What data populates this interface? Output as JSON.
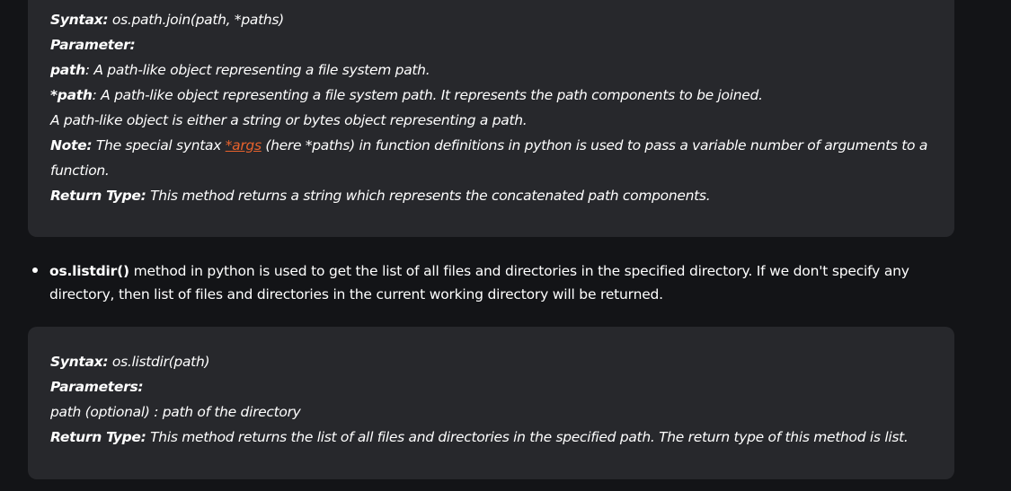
{
  "block1": {
    "syntax_label": "Syntax:",
    "syntax_value": " os.path.join(path, *paths)",
    "parameter_label": "Parameter:",
    "path_label": "path",
    "path_desc": ": A path-like object representing a file system path.",
    "star_path_label": "*path",
    "star_path_desc": ": A path-like object representing a file system path. It represents the path components to be joined.",
    "pathlike_note": "A path-like object is either a string or bytes object representing a path.",
    "note_label": "Note:",
    "note_pre": " The special syntax ",
    "note_link": "*args",
    "note_post": " (here *paths) in function definitions in python is used to pass a variable number of arguments to a function.",
    "return_label": "Return Type:",
    "return_desc": " This method returns a string which represents the concatenated path components."
  },
  "bullet": {
    "method": "os.listdir()",
    "text": " method in python is used to get the list of all files and directories in the specified directory. If we don't specify any directory, then list of files and directories in the current working directory will be returned."
  },
  "block2": {
    "syntax_label": "Syntax:",
    "syntax_value": " os.listdir(path)",
    "parameters_label": "Parameters:",
    "path_optional": "path (optional) : path of the directory",
    "return_label": "Return Type:",
    "return_desc": " This method returns the list of all files and directories in the specified path. The return type of this method is list."
  }
}
